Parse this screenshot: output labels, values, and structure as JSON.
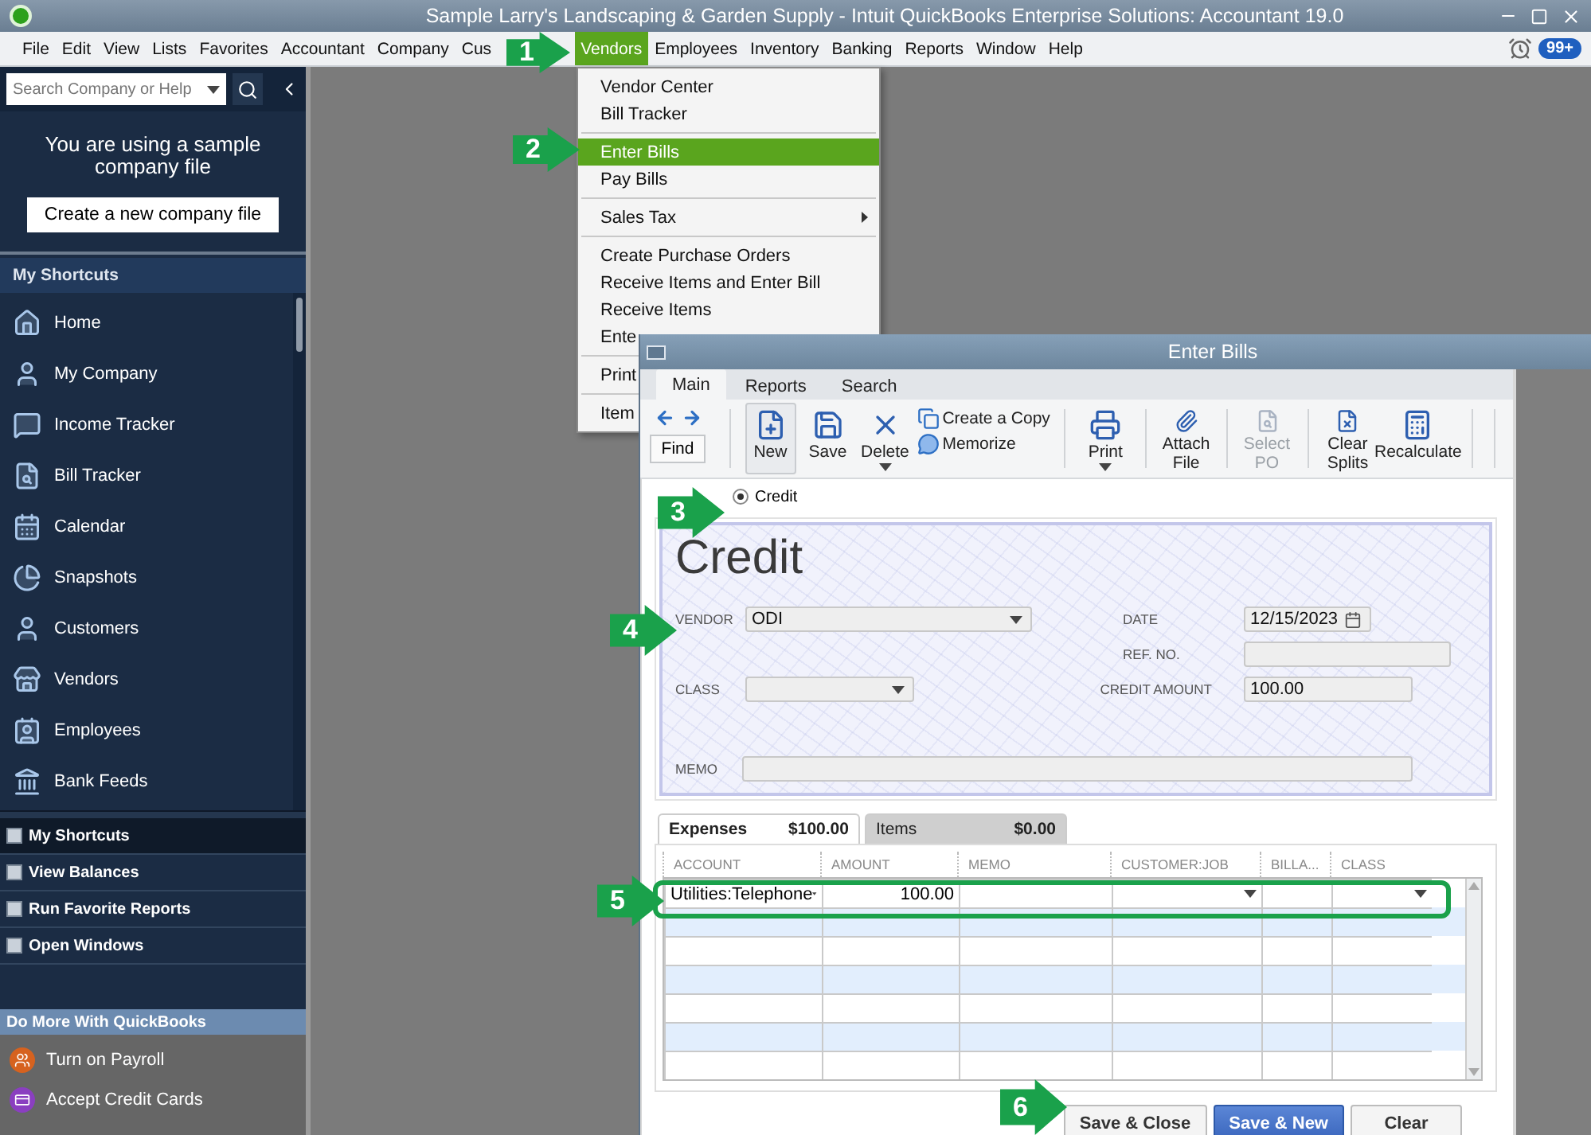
{
  "window": {
    "title": "Sample Larry's Landscaping & Garden Supply - Intuit QuickBooks Enterprise Solutions: Accountant 19.0"
  },
  "menu_bar": {
    "items": [
      {
        "label": "File",
        "selected": false
      },
      {
        "label": "Edit",
        "selected": false
      },
      {
        "label": "View",
        "selected": false
      },
      {
        "label": "Lists",
        "selected": false
      },
      {
        "label": "Favorites",
        "selected": false
      },
      {
        "label": "Accountant",
        "selected": false
      },
      {
        "label": "Company",
        "selected": false
      },
      {
        "label": "Cus",
        "selected": false
      },
      {
        "label": "Vendors",
        "selected": true
      },
      {
        "label": "Employees",
        "selected": false
      },
      {
        "label": "Inventory",
        "selected": false
      },
      {
        "label": "Banking",
        "selected": false
      },
      {
        "label": "Reports",
        "selected": false
      },
      {
        "label": "Window",
        "selected": false
      },
      {
        "label": "Help",
        "selected": false
      }
    ],
    "badge": "99+"
  },
  "vendors_menu": [
    {
      "kind": "item",
      "label": "Vendor Center",
      "selected": false
    },
    {
      "kind": "item",
      "label": "Bill Tracker",
      "selected": false
    },
    {
      "kind": "separator"
    },
    {
      "kind": "item",
      "label": "Enter Bills",
      "selected": true
    },
    {
      "kind": "item",
      "label": "Pay Bills",
      "selected": false
    },
    {
      "kind": "separator"
    },
    {
      "kind": "submenu",
      "label": "Sales Tax",
      "selected": false
    },
    {
      "kind": "separator"
    },
    {
      "kind": "item",
      "label": "Create Purchase Orders",
      "selected": false
    },
    {
      "kind": "item",
      "label": "Receive Items and Enter Bill",
      "selected": false
    },
    {
      "kind": "item",
      "label": "Receive Items",
      "selected": false
    },
    {
      "kind": "item",
      "label": "Ente",
      "selected": false
    },
    {
      "kind": "separator"
    },
    {
      "kind": "item",
      "label": "Print",
      "selected": false
    },
    {
      "kind": "separator"
    },
    {
      "kind": "item",
      "label": "Item",
      "selected": false
    }
  ],
  "sidebar": {
    "search": {
      "placeholder": "Search Company or Help"
    },
    "notice": "You are using a sample company file",
    "create_button": "Create a new company file",
    "shortcuts_header": "My Shortcuts",
    "shortcuts": [
      "Home",
      "My Company",
      "Income Tracker",
      "Bill Tracker",
      "Calendar",
      "Snapshots",
      "Customers",
      "Vendors",
      "Employees",
      "Bank Feeds"
    ],
    "nav": [
      {
        "label": "My Shortcuts",
        "selected": true
      },
      {
        "label": "View Balances",
        "selected": false
      },
      {
        "label": "Run Favorite Reports",
        "selected": false
      },
      {
        "label": "Open Windows",
        "selected": false
      }
    ],
    "more_header": "Do More With QuickBooks",
    "more_items": [
      "Turn on Payroll",
      "Accept Credit Cards"
    ]
  },
  "enter_bills": {
    "title": "Enter Bills",
    "tabs": [
      {
        "label": "Main",
        "selected": true
      },
      {
        "label": "Reports",
        "selected": false
      },
      {
        "label": "Search",
        "selected": false
      }
    ],
    "find": "Find",
    "toolbar": [
      {
        "kind": "large",
        "label": "New",
        "pressed": true,
        "disabled": false,
        "menu": false
      },
      {
        "kind": "large",
        "label": "Save",
        "pressed": false,
        "disabled": false,
        "menu": false
      },
      {
        "kind": "large",
        "label": "Delete",
        "pressed": false,
        "disabled": false,
        "menu": true
      },
      {
        "kind": "stack",
        "items": [
          "Create a Copy",
          "Memorize"
        ]
      },
      {
        "kind": "divider"
      },
      {
        "kind": "large",
        "label": "Print",
        "pressed": false,
        "disabled": false,
        "menu": true
      },
      {
        "kind": "divider"
      },
      {
        "kind": "large",
        "label": "Attach File",
        "pressed": false,
        "disabled": false,
        "menu": false
      },
      {
        "kind": "divider"
      },
      {
        "kind": "large",
        "label": "Select PO",
        "pressed": false,
        "disabled": true,
        "menu": false
      },
      {
        "kind": "divider"
      },
      {
        "kind": "large",
        "label": "Clear Splits",
        "pressed": false,
        "disabled": false,
        "menu": false
      },
      {
        "kind": "large",
        "label": "Recalculate",
        "pressed": false,
        "disabled": false,
        "menu": false
      },
      {
        "kind": "divider"
      },
      {
        "kind": "divider"
      }
    ],
    "mode": {
      "label": "Credit",
      "checked": true
    },
    "form_title": "Credit",
    "vendor": {
      "label": "VENDOR",
      "value": "ODI"
    },
    "date": {
      "label": "DATE",
      "value": "12/15/2023"
    },
    "ref_no": {
      "label": "REF. NO."
    },
    "class": {
      "label": "CLASS"
    },
    "credit_amount": {
      "label": "CREDIT AMOUNT",
      "value": "100.00"
    },
    "memo": {
      "label": "MEMO"
    },
    "detail_tabs": [
      {
        "label": "Expenses",
        "amount": "$100.00",
        "selected": true
      },
      {
        "label": "Items",
        "amount": "$0.00",
        "selected": false
      }
    ],
    "columns": [
      "ACCOUNT",
      "AMOUNT",
      "MEMO",
      "CUSTOMER:JOB",
      "BILLA...",
      "CLASS"
    ],
    "rows": [
      {
        "account": "Utilities:Telephone",
        "amount": "100.00"
      }
    ],
    "buttons": [
      {
        "label": "Save & Close",
        "kind": "secondary"
      },
      {
        "label": "Save & New",
        "kind": "primary"
      },
      {
        "label": "Clear",
        "kind": "secondary"
      }
    ]
  },
  "steps": [
    "1",
    "2",
    "3",
    "4",
    "5",
    "6"
  ]
}
